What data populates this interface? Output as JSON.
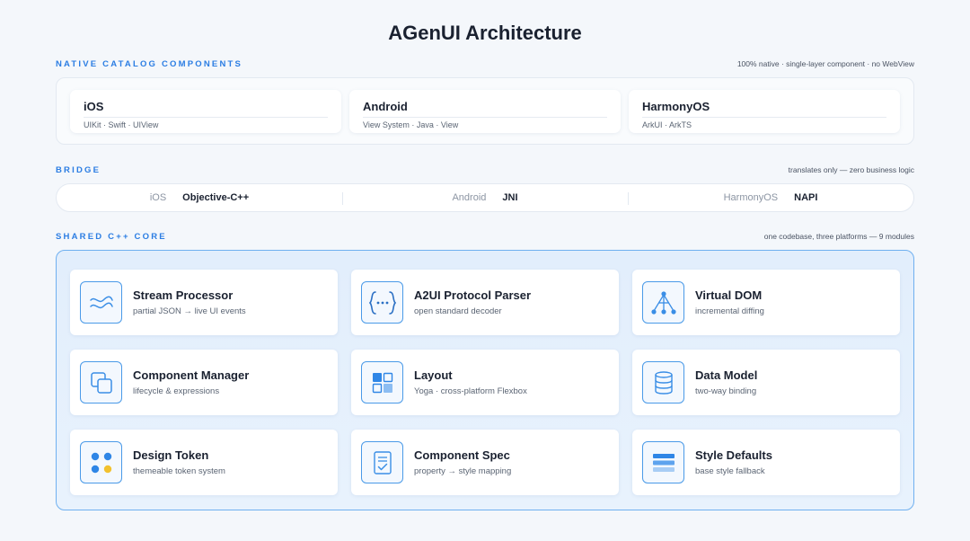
{
  "title": "AGenUI Architecture",
  "native": {
    "label": "NATIVE CATALOG COMPONENTS",
    "note": "100% native · single-layer component · no WebView",
    "platforms": [
      {
        "name": "iOS",
        "stack": "UIKit · Swift · UIView"
      },
      {
        "name": "Android",
        "stack": "View System · Java · View"
      },
      {
        "name": "HarmonyOS",
        "stack": "ArkUI · ArkTS"
      }
    ]
  },
  "bridge": {
    "label": "BRIDGE",
    "note": "translates only — zero business logic",
    "segments": [
      {
        "platform": "iOS",
        "tech": "Objective-C++"
      },
      {
        "platform": "Android",
        "tech": "JNI"
      },
      {
        "platform": "HarmonyOS",
        "tech": "NAPI"
      }
    ]
  },
  "core": {
    "label": "SHARED C++ CORE",
    "note": "one codebase, three platforms — 9 modules",
    "modules": [
      {
        "name": "Stream Processor",
        "desc": "partial JSON → live UI events",
        "icon": "wave-icon"
      },
      {
        "name": "A2UI Protocol Parser",
        "desc": "open standard decoder",
        "icon": "braces-icon"
      },
      {
        "name": "Virtual DOM",
        "desc": "incremental diffing",
        "icon": "tree-icon"
      },
      {
        "name": "Component Manager",
        "desc": "lifecycle & expressions",
        "icon": "stacked-squares-icon"
      },
      {
        "name": "Layout",
        "desc": "Yoga · cross-platform Flexbox",
        "icon": "grid-icon"
      },
      {
        "name": "Data Model",
        "desc": "two-way binding",
        "icon": "database-icon"
      },
      {
        "name": "Design Token",
        "desc": "themeable token system",
        "icon": "color-dots-icon"
      },
      {
        "name": "Component Spec",
        "desc": "property → style mapping",
        "icon": "document-check-icon"
      },
      {
        "name": "Style Defaults",
        "desc": "base style fallback",
        "icon": "stacked-lines-icon"
      }
    ]
  },
  "colors": {
    "accent": "#2b7de3",
    "icon_blue": "#3a8ee6",
    "token_yellow": "#f2c12e",
    "core_border": "#6fb0f0"
  }
}
